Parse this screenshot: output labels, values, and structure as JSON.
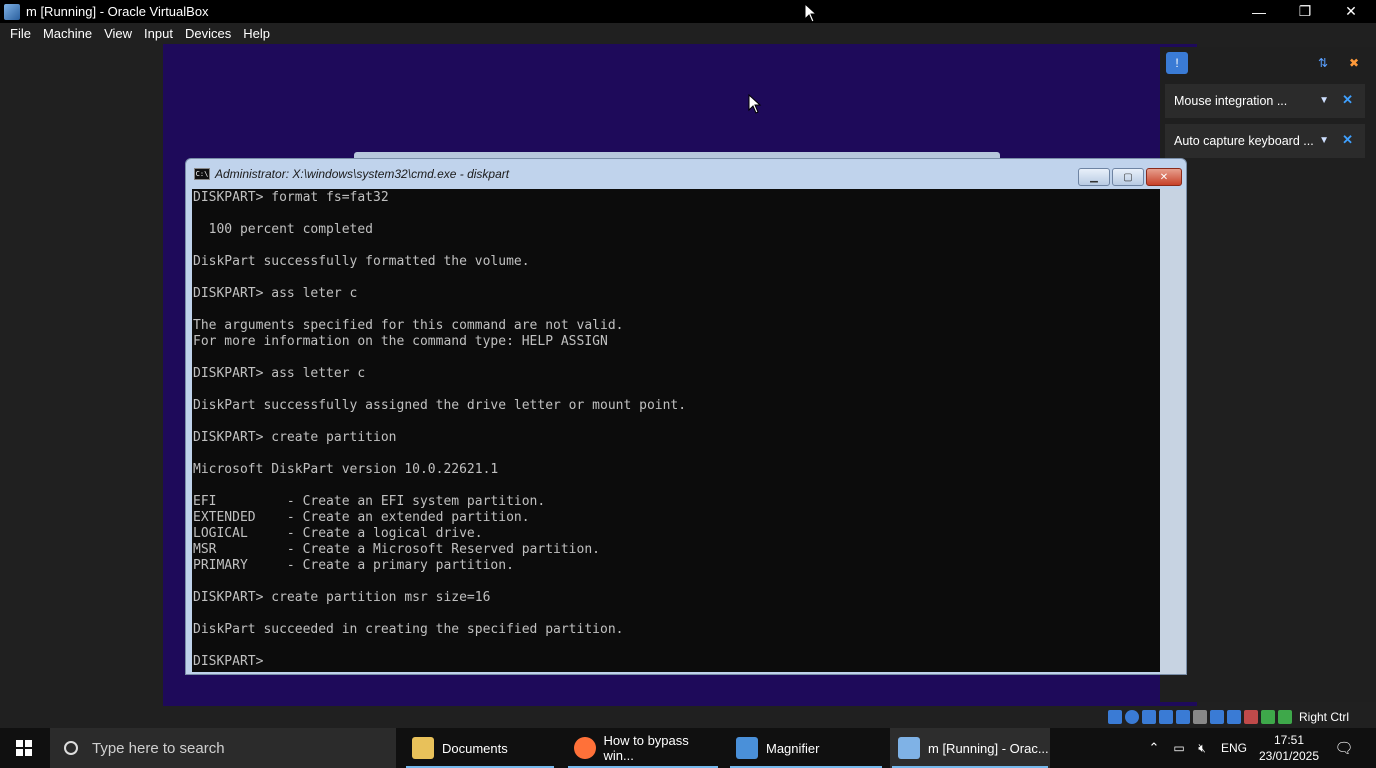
{
  "window": {
    "title": "m [Running] - Oracle VirtualBox",
    "minimize_glyph": "—",
    "restore_glyph": "❐",
    "close_glyph": "✕"
  },
  "menu": [
    "File",
    "Machine",
    "View",
    "Input",
    "Devices",
    "Help"
  ],
  "notifications": [
    {
      "text": "Mouse integration ..."
    },
    {
      "text": "Auto capture keyboard ..."
    }
  ],
  "cmd": {
    "title": "Administrator: X:\\windows\\system32\\cmd.exe - diskpart",
    "icon_text": "C:\\",
    "lines": [
      "DISKPART> format fs=fat32",
      "",
      "  100 percent completed",
      "",
      "DiskPart successfully formatted the volume.",
      "",
      "DISKPART> ass leter c",
      "",
      "The arguments specified for this command are not valid.",
      "For more information on the command type: HELP ASSIGN",
      "",
      "DISKPART> ass letter c",
      "",
      "DiskPart successfully assigned the drive letter or mount point.",
      "",
      "DISKPART> create partition",
      "",
      "Microsoft DiskPart version 10.0.22621.1",
      "",
      "EFI         - Create an EFI system partition.",
      "EXTENDED    - Create an extended partition.",
      "LOGICAL     - Create a logical drive.",
      "MSR         - Create a Microsoft Reserved partition.",
      "PRIMARY     - Create a primary partition.",
      "",
      "DISKPART> create partition msr size=16",
      "",
      "DiskPart succeeded in creating the specified partition.",
      "",
      "DISKPART>"
    ]
  },
  "statusbar": {
    "host_key": "Right Ctrl"
  },
  "taskbar": {
    "search_placeholder": "Type here to search",
    "items": [
      {
        "label": "Documents",
        "icon": "documents-icon",
        "color": "#e8c15a"
      },
      {
        "label": "How to bypass win...",
        "icon": "firefox-icon",
        "color": "#ff7139"
      },
      {
        "label": "Magnifier",
        "icon": "magnifier-icon",
        "color": "#4a90d9"
      },
      {
        "label": "m [Running] - Orac...",
        "icon": "virtualbox-icon",
        "color": "#7fb2e6"
      }
    ],
    "language": "ENG",
    "time": "17:51",
    "date": "23/01/2025"
  },
  "colors": {
    "vm_background": "#1e0a5a",
    "console_background": "#0c0c0c",
    "console_text": "#c0c0c0",
    "accent": "#76b9ed"
  }
}
